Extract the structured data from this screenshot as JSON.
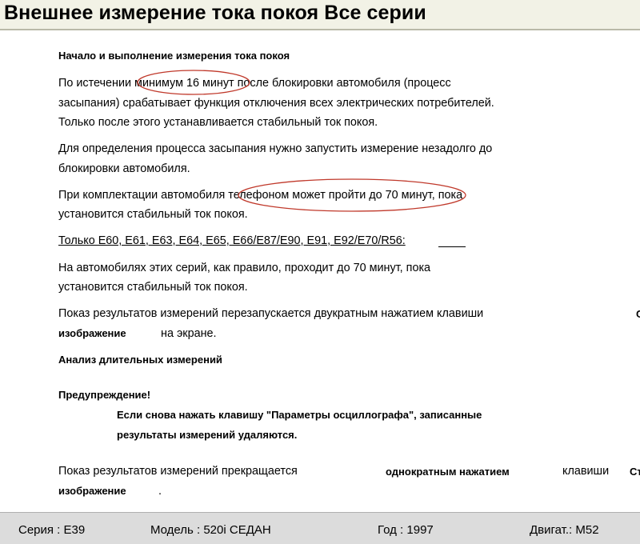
{
  "header": {
    "title": "Внешнее измерение тока покоя Все серии"
  },
  "content": {
    "heading_start": "Начало и выполнение измерения тока покоя",
    "p1": [
      "По истечении минимум 16 минут после блокировки автомобиля (процесс",
      "засыпания) срабатывает функция отключения всех электрических потребителей.",
      "Только после этого устанавливается стабильный ток покоя."
    ],
    "p2": [
      "Для определения процесса засыпания нужно запустить измерение незадолго до",
      "блокировки автомобиля."
    ],
    "p3": [
      "При комплектации автомобиля телефоном может пройти до 70 минут, пока",
      "установится стабильный ток покоя."
    ],
    "series_note": "Только E60, E61, E63, E64, E65, E66/E87/E90, E91, E92/E70/R56:",
    "p4": [
      "На автомобилях этих серий, как правило, проходит до 70 минут, пока",
      "установится стабильный ток покоя."
    ],
    "p5": {
      "text": "Показ результатов измерений перезапускается двукратным нажатием клавиши",
      "cut_char": "С",
      "key_label": "изображение",
      "tail": "на экране."
    },
    "heading_analysis": "Анализ длительных измерений",
    "warning_title": "Предупреждение!",
    "warning": [
      "Если снова нажать клавишу \"Параметры осциллографа\", записанные",
      "результаты измерений удаляются."
    ],
    "p6": {
      "text": "Показ результатов измерений прекращается",
      "bold": "однократным нажатием",
      "word": "клавиши",
      "cut": "Ст",
      "key_label": "изображение",
      "tail": "."
    }
  },
  "footer": {
    "series": "Серия : E39",
    "model": "Модель : 520i СЕДАН",
    "year": "Год : 1997",
    "engine": "Двигат.: M52"
  },
  "colors": {
    "header_bg": "#f2f2e6",
    "footer_bg": "#dcdcdc",
    "annotation": "#c0392b"
  }
}
